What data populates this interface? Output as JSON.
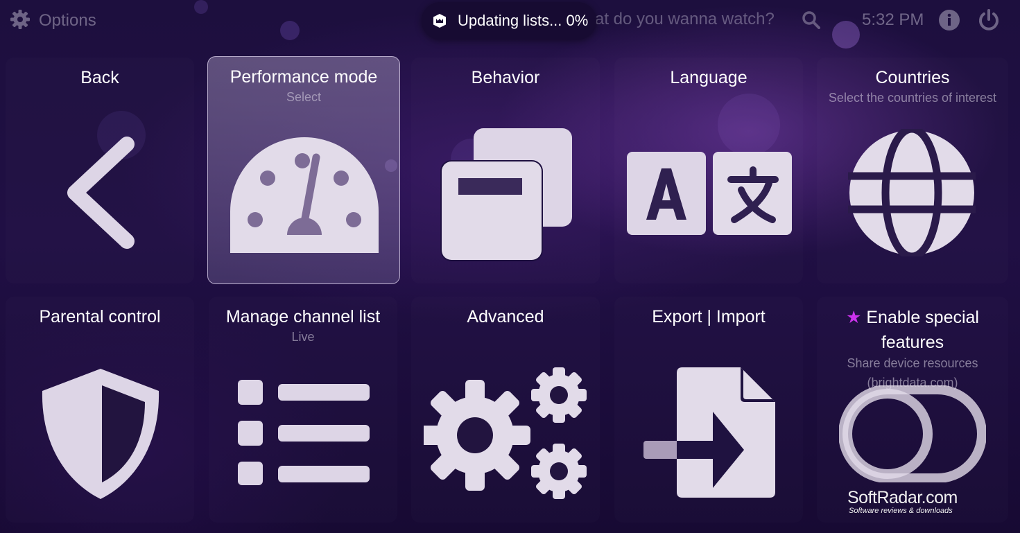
{
  "topbar": {
    "options_label": "Options",
    "search_placeholder": "at do you wanna watch?",
    "time": "5:32 PM",
    "toast_text": "Updating lists... 0%"
  },
  "tiles": [
    {
      "title": "Back",
      "subtitle": "",
      "icon": "chevron-left-icon"
    },
    {
      "title": "Performance mode",
      "subtitle": "Select",
      "icon": "speedometer-icon"
    },
    {
      "title": "Behavior",
      "subtitle": "",
      "icon": "windows-icon"
    },
    {
      "title": "Language",
      "subtitle": "",
      "icon": "translate-icon"
    },
    {
      "title": "Countries",
      "subtitle": "Select the countries of interest",
      "icon": "globe-icon"
    },
    {
      "title": "Parental control",
      "subtitle": "",
      "icon": "shield-icon"
    },
    {
      "title": "Manage channel list",
      "subtitle": "Live",
      "icon": "list-icon"
    },
    {
      "title": "Advanced",
      "subtitle": "",
      "icon": "gears-icon"
    },
    {
      "title": "Export | Import",
      "subtitle": "",
      "icon": "file-import-icon"
    },
    {
      "title_line1": "Enable special",
      "title_line2": "features",
      "subtitle_line1": "Share device resources",
      "subtitle_line2": "(brightdata.com)",
      "icon": "toggle-icon",
      "star": "★"
    }
  ],
  "watermark": {
    "name": "SoftRadar.com",
    "tagline": "Software reviews & downloads"
  },
  "colors": {
    "accent_star": "#cc33ee",
    "icon_fill": "#e2dbe9",
    "background": "#1d0f3e"
  }
}
